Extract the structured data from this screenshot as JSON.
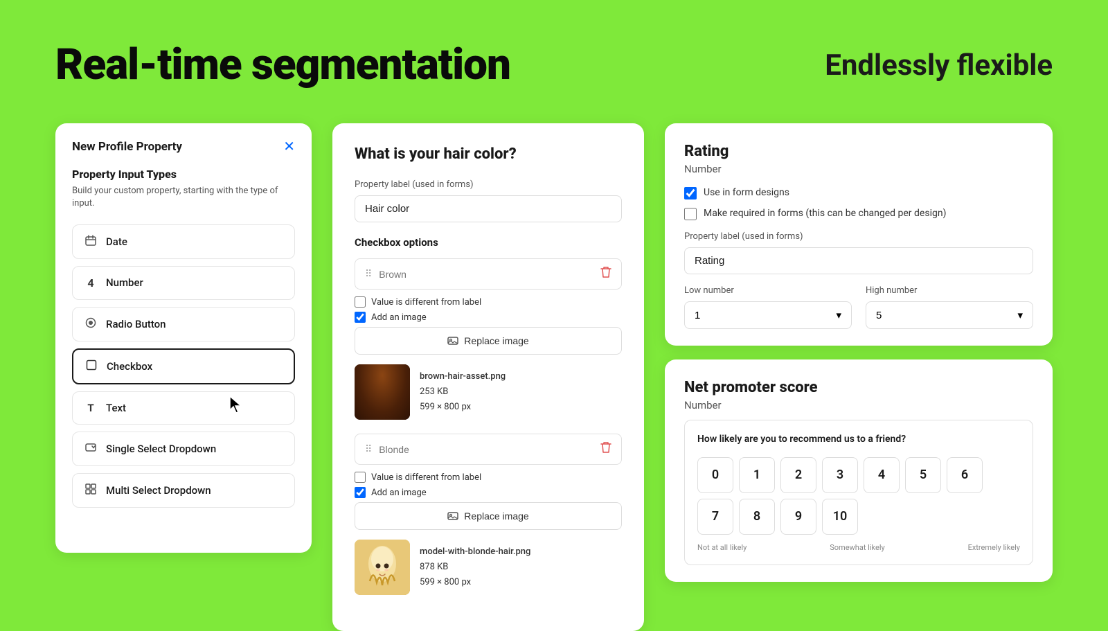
{
  "page": {
    "background_color": "#7fe93a",
    "main_title": "Real-time segmentation",
    "sub_title": "Endlessly flexible"
  },
  "left_panel": {
    "title": "New Profile Property",
    "close_label": "✕",
    "section_title": "Property Input Types",
    "section_desc": "Build your custom property, starting with the type of input.",
    "items": [
      {
        "id": "date",
        "label": "Date",
        "icon": "📅"
      },
      {
        "id": "number",
        "label": "Number",
        "icon": "4"
      },
      {
        "id": "radio",
        "label": "Radio Button",
        "icon": "◎"
      },
      {
        "id": "checkbox",
        "label": "Checkbox",
        "icon": "☐",
        "active": true
      },
      {
        "id": "text",
        "label": "Text",
        "icon": "T"
      },
      {
        "id": "single-select",
        "label": "Single Select Dropdown",
        "icon": "▼"
      },
      {
        "id": "multi-select",
        "label": "Multi Select Dropdown",
        "icon": "⊞"
      }
    ]
  },
  "middle_panel": {
    "form_title": "What is your hair color?",
    "property_label_label": "Property label (used in forms)",
    "property_label_value": "Hair color",
    "checkbox_options_label": "Checkbox options",
    "option1": {
      "placeholder": "Brown",
      "value_diff_label": "Value is different from label",
      "value_diff_checked": false,
      "add_image_label": "Add an image",
      "add_image_checked": true,
      "replace_button": "Replace image",
      "filename": "brown-hair-asset.png",
      "filesize": "253 KB",
      "dimensions": "599 × 800 px"
    },
    "option2": {
      "placeholder": "Blonde",
      "value_diff_label": "Value is different from label",
      "value_diff_checked": false,
      "add_image_label": "Add an image",
      "add_image_checked": true,
      "replace_button": "Replace image",
      "filename": "model-with-blonde-hair.png",
      "filesize": "878 KB",
      "dimensions": "599 × 800 px"
    }
  },
  "rating_panel": {
    "title": "Rating",
    "subtitle": "Number",
    "use_in_forms_label": "Use in form designs",
    "use_in_forms_checked": true,
    "make_required_label": "Make required in forms (this can be changed per design)",
    "make_required_checked": false,
    "property_label_label": "Property label (used in forms)",
    "property_label_value": "Rating",
    "low_number_label": "Low number",
    "low_number_value": "1",
    "high_number_label": "High number",
    "high_number_value": "5"
  },
  "nps_panel": {
    "title": "Net promoter score",
    "subtitle": "Number",
    "nps_question": "How likely are you to recommend us to a friend?",
    "numbers_row1": [
      "0",
      "1",
      "2",
      "3",
      "4",
      "5",
      "6"
    ],
    "numbers_row2": [
      "7",
      "8",
      "9",
      "10"
    ],
    "label_left": "Not at all likely",
    "label_middle": "Somewhat likely",
    "label_right": "Extremely likely"
  },
  "icons": {
    "close": "✕",
    "drag": "⠿",
    "delete": "🗑",
    "image": "🖼",
    "dropdown": "▾",
    "calendar": "◫",
    "check": "✓"
  }
}
